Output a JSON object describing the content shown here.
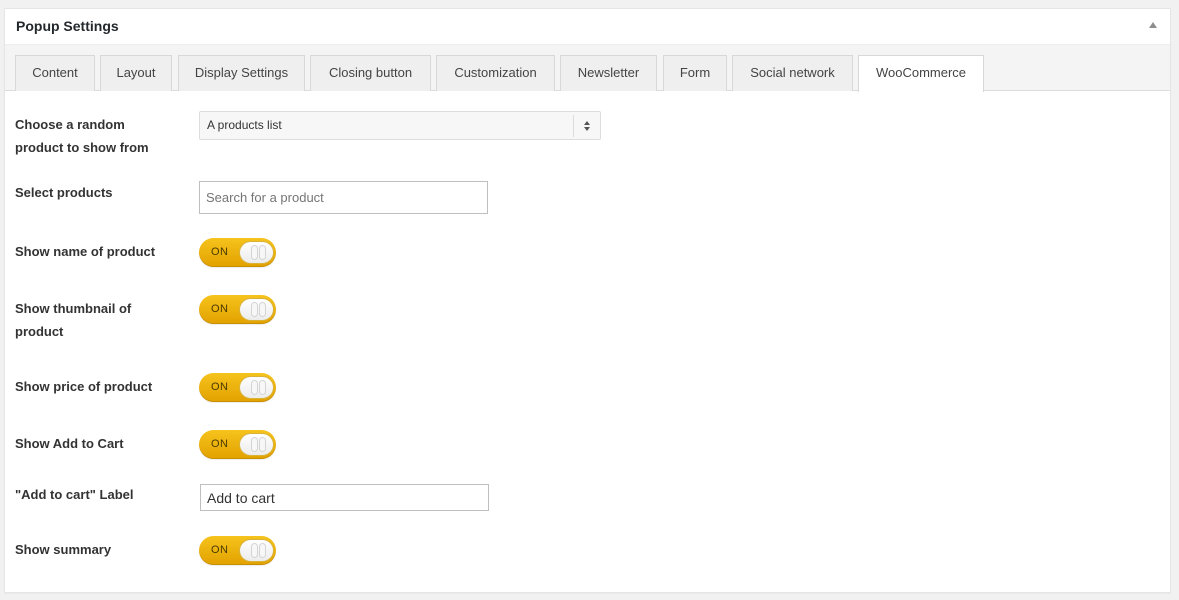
{
  "panel": {
    "title": "Popup Settings"
  },
  "tabs": [
    {
      "label": "Content"
    },
    {
      "label": "Layout"
    },
    {
      "label": "Display Settings"
    },
    {
      "label": "Closing button"
    },
    {
      "label": "Customization"
    },
    {
      "label": "Newsletter"
    },
    {
      "label": "Form"
    },
    {
      "label": "Social network"
    },
    {
      "label": "WooCommerce",
      "active": true
    }
  ],
  "fields": {
    "random_product": {
      "label": "Choose a random product to show from",
      "selected": "A products list"
    },
    "select_products": {
      "label": "Select products",
      "placeholder": "Search for a product"
    },
    "show_name": {
      "label": "Show name of product",
      "state": "ON"
    },
    "show_thumbnail": {
      "label": "Show thumbnail of product",
      "state": "ON"
    },
    "show_price": {
      "label": "Show price of product",
      "state": "ON"
    },
    "show_add_to_cart": {
      "label": "Show Add to Cart",
      "state": "ON"
    },
    "add_to_cart_label": {
      "label": "\"Add to cart\" Label",
      "value": "Add to cart"
    },
    "show_summary": {
      "label": "Show summary",
      "state": "ON"
    }
  },
  "colors": {
    "toggle_on": "#f0b80f",
    "panel_bg": "#ffffff",
    "page_bg": "#f1f1f1"
  }
}
